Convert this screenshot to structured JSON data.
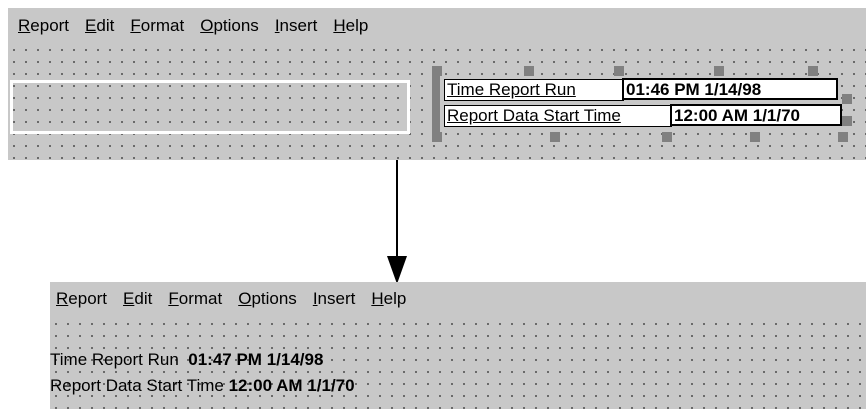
{
  "menu": [
    {
      "label": "Report",
      "mnemonic": "R"
    },
    {
      "label": "Edit",
      "mnemonic": "E"
    },
    {
      "label": "Format",
      "mnemonic": "F"
    },
    {
      "label": "Options",
      "mnemonic": "O"
    },
    {
      "label": "Insert",
      "mnemonic": "I"
    },
    {
      "label": "Help",
      "mnemonic": "H"
    }
  ],
  "before": {
    "field1_label": "Time Report Run",
    "field1_value": "01:46 PM  1/14/98",
    "field2_label": "Report Data Start Time",
    "field2_value": "12:00 AM  1/1/70"
  },
  "after": {
    "line1_label": "Time Report Run",
    "line1_value": "01:47 PM  1/14/98",
    "line2_label": "Report Data Start Time",
    "line2_value": "12:00 AM  1/1/70"
  },
  "colors": {
    "panel_bg": "#c8c8c8",
    "selection_handle": "#808080"
  }
}
